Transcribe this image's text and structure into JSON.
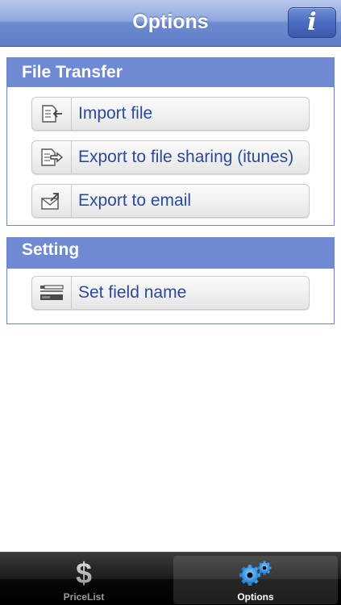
{
  "navbar": {
    "title": "Options",
    "info_button": "i"
  },
  "sections": [
    {
      "title": "File Transfer",
      "items": [
        {
          "label": "Import file",
          "icon": "import-file-icon"
        },
        {
          "label": "Export to file sharing (itunes)",
          "icon": "export-file-icon"
        },
        {
          "label": "Export to email",
          "icon": "email-icon"
        }
      ]
    },
    {
      "title": "Setting",
      "items": [
        {
          "label": "Set field name",
          "icon": "field-name-icon"
        }
      ]
    }
  ],
  "tabbar": {
    "tabs": [
      {
        "label": "PriceList",
        "icon": "dollar-icon",
        "glyph": "$",
        "selected": false
      },
      {
        "label": "Options",
        "icon": "gears-icon",
        "selected": true
      }
    ]
  },
  "colors": {
    "nav_blue": "#6e8bd0",
    "section_header": "#6f89d3",
    "label_blue": "#2b4a9d"
  }
}
